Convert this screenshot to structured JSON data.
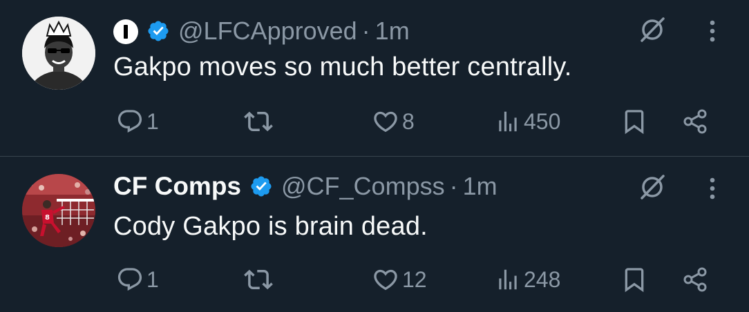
{
  "tweets": [
    {
      "name": "",
      "handle": "@LFCApproved",
      "separator": "·",
      "time": "1m",
      "text": "Gakpo moves so much better centrally.",
      "replies": "1",
      "retweets": "",
      "likes": "8",
      "views": "450"
    },
    {
      "name": "CF Comps",
      "handle": "@CF_Compss",
      "separator": "·",
      "time": "1m",
      "text": "Cody Gakpo is brain dead.",
      "replies": "1",
      "retweets": "",
      "likes": "12",
      "views": "248"
    }
  ],
  "icons": {
    "verified": "verified-badge-icon",
    "grok": "grok-icon",
    "more": "more-icon",
    "reply": "reply-icon",
    "retweet": "retweet-icon",
    "like": "heart-icon",
    "views": "views-icon",
    "bookmark": "bookmark-icon",
    "share": "share-icon"
  },
  "colors": {
    "background": "#15202b",
    "text_primary": "#f7f9f9",
    "text_secondary": "#8b98a5",
    "verified_blue": "#1d9bf0",
    "divider": "#38444d"
  }
}
